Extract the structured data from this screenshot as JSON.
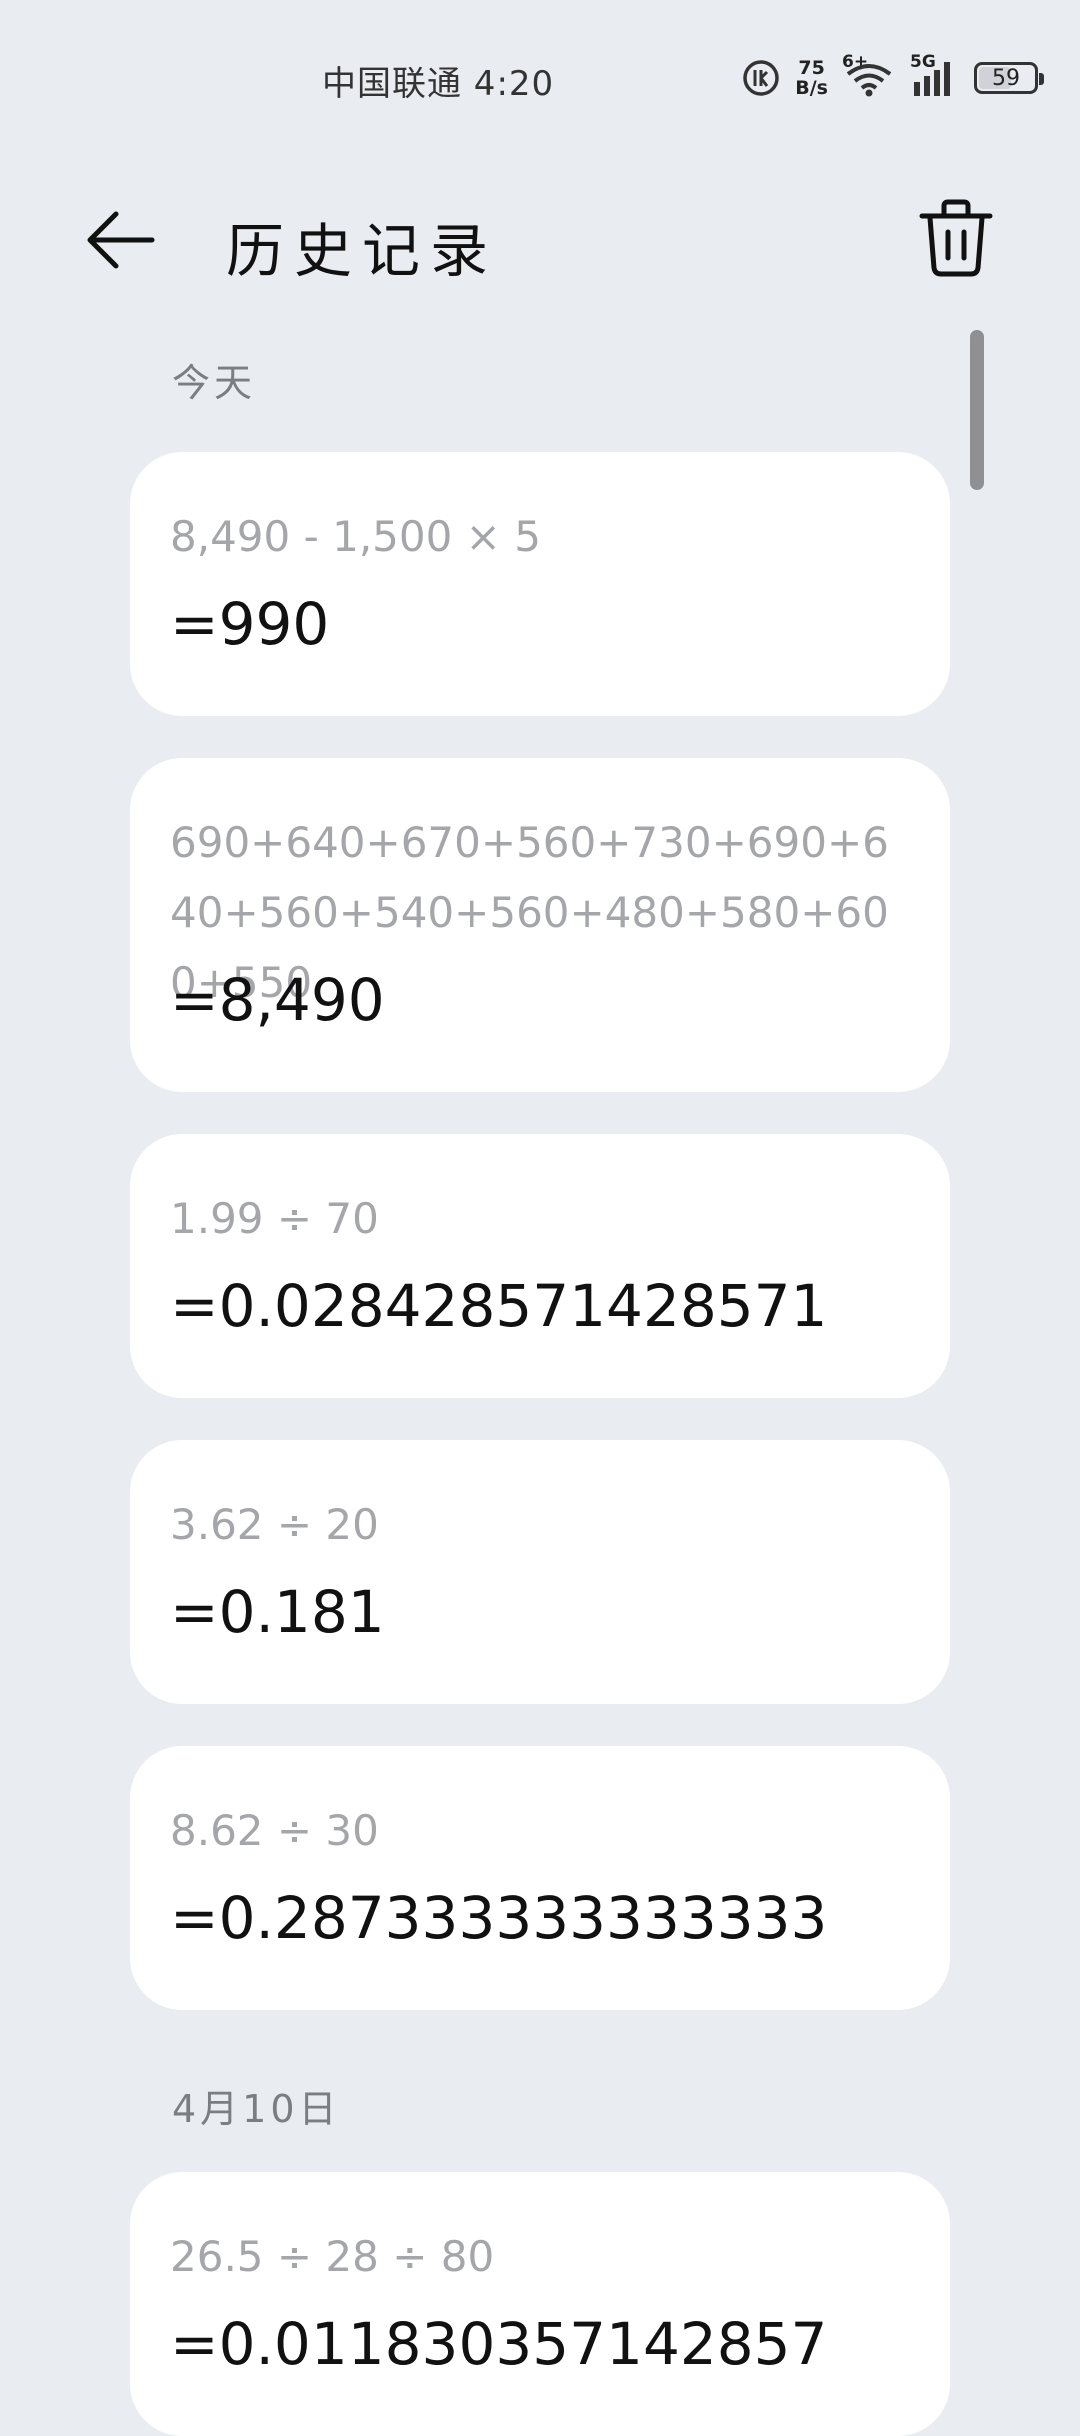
{
  "status_bar": {
    "carrier_time": "中国联通 4:20",
    "net_speed_value": "75",
    "net_speed_unit": "B/s",
    "wifi_badge": "6+",
    "signal_label": "5G",
    "battery": "59",
    "battery_level": 0.59
  },
  "header": {
    "title": "历史记录"
  },
  "sections": [
    {
      "label": "今天",
      "items": [
        {
          "expression": "8,490 - 1,500 × 5",
          "result": "=990"
        },
        {
          "expression": "690+640+670+560+730+690+640+560+540+560+480+580+600+550",
          "result": "=8,490"
        },
        {
          "expression": "1.99 ÷ 70",
          "result": "=0.028428571428571"
        },
        {
          "expression": "3.62 ÷ 20",
          "result": "=0.181"
        },
        {
          "expression": "8.62 ÷ 30",
          "result": "=0.287333333333333"
        }
      ]
    },
    {
      "label": "4月10日",
      "items": [
        {
          "expression": "26.5 ÷ 28 ÷ 80",
          "result": "=0.011830357142857"
        }
      ]
    }
  ]
}
